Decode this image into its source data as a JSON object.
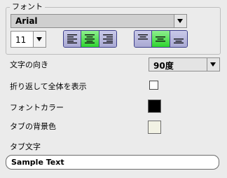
{
  "font_group": {
    "legend": "フォント",
    "font_name": "Arial",
    "font_size": "11",
    "horizontal_align": [
      {
        "name": "align-left-icon",
        "active": false
      },
      {
        "name": "align-center-icon",
        "active": true
      },
      {
        "name": "align-right-icon",
        "active": false
      }
    ],
    "vertical_align": [
      {
        "name": "align-top-icon",
        "active": false
      },
      {
        "name": "align-middle-icon",
        "active": true
      },
      {
        "name": "align-bottom-icon",
        "active": false
      }
    ]
  },
  "text_direction": {
    "label": "文字の向き",
    "value": "90度"
  },
  "wrap": {
    "label": "折り返して全体を表示",
    "checked": false
  },
  "font_color": {
    "label": "フォントカラー",
    "color": "#000000"
  },
  "tab_bg": {
    "label": "タブの背景色",
    "color": "#f2f2e4"
  },
  "tab_text": {
    "label": "タブ文字",
    "value": "Sample Text"
  },
  "colors": {
    "panel_bg": "#ebebeb",
    "active_button": "#2fd42f",
    "button_border": "#3d3f8a"
  }
}
